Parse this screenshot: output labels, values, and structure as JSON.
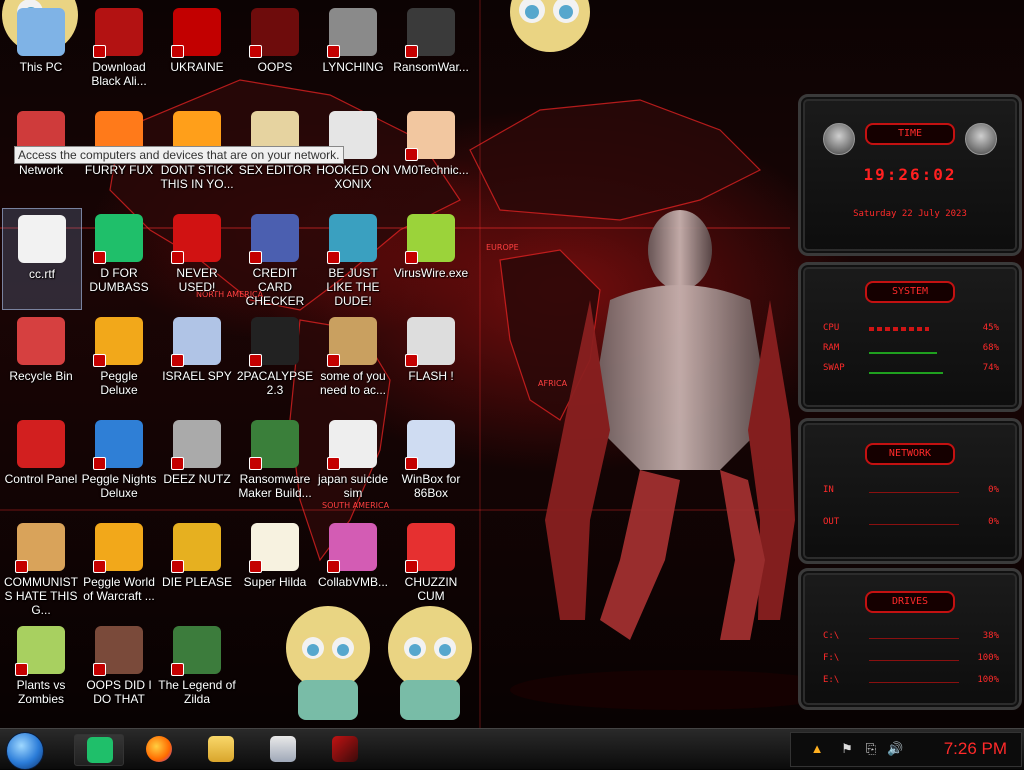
{
  "desktop": {
    "tooltip": "Access the computers and devices that are on your network.",
    "icons": [
      {
        "label": "This PC"
      },
      {
        "label": "Download Black Ali..."
      },
      {
        "label": "UKRAINE"
      },
      {
        "label": "OOPS"
      },
      {
        "label": "LYNCHING"
      },
      {
        "label": "RansomWar..."
      },
      {
        "label": "Network"
      },
      {
        "label": "FURRY FUX"
      },
      {
        "label": "DONT STICK THIS IN YO..."
      },
      {
        "label": "SEX EDITOR"
      },
      {
        "label": "HOOKED ON XONIX"
      },
      {
        "label": "VM0Technic..."
      },
      {
        "label": "cc.rtf"
      },
      {
        "label": "D FOR DUMBASS"
      },
      {
        "label": "NEVER USED!"
      },
      {
        "label": "CREDIT CARD CHECKER"
      },
      {
        "label": "BE JUST LIKE THE DUDE!"
      },
      {
        "label": "VirusWire.exe"
      },
      {
        "label": "Recycle Bin"
      },
      {
        "label": "Peggle Deluxe"
      },
      {
        "label": "ISRAEL SPY"
      },
      {
        "label": "2PACALYPSE 2.3"
      },
      {
        "label": "some of you need to ac..."
      },
      {
        "label": "FLASH !"
      },
      {
        "label": "Control Panel"
      },
      {
        "label": "Peggle Nights Deluxe"
      },
      {
        "label": "DEEZ NUTZ"
      },
      {
        "label": "Ransomware Maker Build..."
      },
      {
        "label": "japan suicide sim"
      },
      {
        "label": "WinBox for 86Box"
      },
      {
        "label": "COMMUNISTS HATE THIS G..."
      },
      {
        "label": "Peggle World of Warcraft ..."
      },
      {
        "label": "DIE PLEASE"
      },
      {
        "label": "Super Hilda"
      },
      {
        "label": "CollabVMB..."
      },
      {
        "label": "CHUZZIN CUM"
      },
      {
        "label": "Plants vs Zombies"
      },
      {
        "label": "OOPS DID I DO THAT"
      },
      {
        "label": "The Legend of Zilda"
      }
    ]
  },
  "map_labels": {
    "north_america": "NORTH AMERICA",
    "south_america": "SOUTH AMERICA",
    "europe": "EUROPE",
    "africa": "AFRICA"
  },
  "widgets": {
    "time": {
      "title": "TIME",
      "clock": "19:26:02",
      "date": "Saturday 22 July 2023"
    },
    "system": {
      "title": "SYSTEM",
      "rows": [
        {
          "key": "CPU",
          "value": "45%",
          "percent": 45
        },
        {
          "key": "RAM",
          "value": "68%",
          "percent": 68
        },
        {
          "key": "SWAP",
          "value": "74%",
          "percent": 74
        }
      ]
    },
    "network": {
      "title": "NETWORK",
      "rows": [
        {
          "key": "IN",
          "value": "0%"
        },
        {
          "key": "OUT",
          "value": "0%"
        }
      ]
    },
    "drives": {
      "title": "DRIVES",
      "rows": [
        {
          "key": "C:\\",
          "value": "38%"
        },
        {
          "key": "F:\\",
          "value": "100%"
        },
        {
          "key": "E:\\",
          "value": "100%"
        }
      ]
    }
  },
  "taskbar": {
    "clock": "7:26 PM",
    "pinned": [
      "d-for-dumbass-icon",
      "firefox-icon",
      "file-explorer-icon",
      "winbox-icon",
      "control-panel-icon"
    ]
  },
  "colors": {
    "accent": "#ff2020",
    "panel": "#141414"
  }
}
